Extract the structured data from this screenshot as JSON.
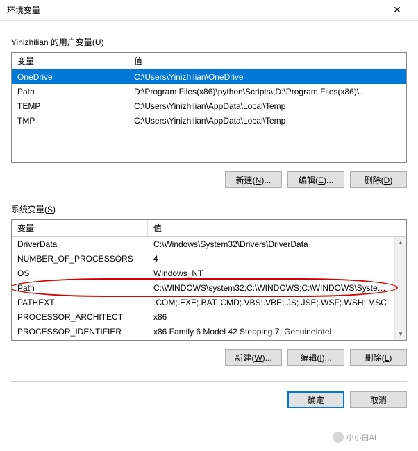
{
  "window": {
    "title": "环境变量",
    "close": "✕"
  },
  "user_section": {
    "label_prefix": "Yinizhilian 的用户变量(",
    "label_hotkey": "U",
    "label_suffix": ")",
    "header_name": "变量",
    "header_value": "值",
    "rows": [
      {
        "name": "OneDrive",
        "value": "C:\\Users\\Yinizhilian\\OneDrive",
        "selected": true
      },
      {
        "name": "Path",
        "value": "D:\\Program Files(x86)\\python\\Scripts\\;D:\\Program Files(x86)\\...",
        "selected": false
      },
      {
        "name": "TEMP",
        "value": "C:\\Users\\Yinizhilian\\AppData\\Local\\Temp",
        "selected": false
      },
      {
        "name": "TMP",
        "value": "C:\\Users\\Yinizhilian\\AppData\\Local\\Temp",
        "selected": false
      }
    ],
    "btn_new": "新建(N)...",
    "btn_edit": "编辑(E)...",
    "btn_delete": "删除(D)"
  },
  "system_section": {
    "label_prefix": "系统变量(",
    "label_hotkey": "S",
    "label_suffix": ")",
    "header_name": "变量",
    "header_value": "值",
    "rows": [
      {
        "name": "DriverData",
        "value": "C:\\Windows\\System32\\Drivers\\DriverData"
      },
      {
        "name": "NUMBER_OF_PROCESSORS",
        "value": "4"
      },
      {
        "name": "OS",
        "value": "Windows_NT"
      },
      {
        "name": "Path",
        "value": "C:\\WINDOWS\\system32;C:\\WINDOWS;C:\\WINDOWS\\System...",
        "highlighted": true
      },
      {
        "name": "PATHEXT",
        "value": ".COM;.EXE;.BAT;.CMD;.VBS;.VBE;.JS;.JSE;.WSF;.WSH;.MSC"
      },
      {
        "name": "PROCESSOR_ARCHITECT",
        "value": "x86"
      },
      {
        "name": "PROCESSOR_IDENTIFIER",
        "value": "x86 Family 6 Model 42 Stepping 7, GenuineIntel"
      }
    ],
    "btn_new": "新建(W)...",
    "btn_edit": "编辑(I)...",
    "btn_delete": "删除(L)"
  },
  "footer": {
    "ok": "确定",
    "cancel": "取消"
  },
  "watermark": "小小白AI",
  "scroll_up": "▲",
  "scroll_down": "▼"
}
